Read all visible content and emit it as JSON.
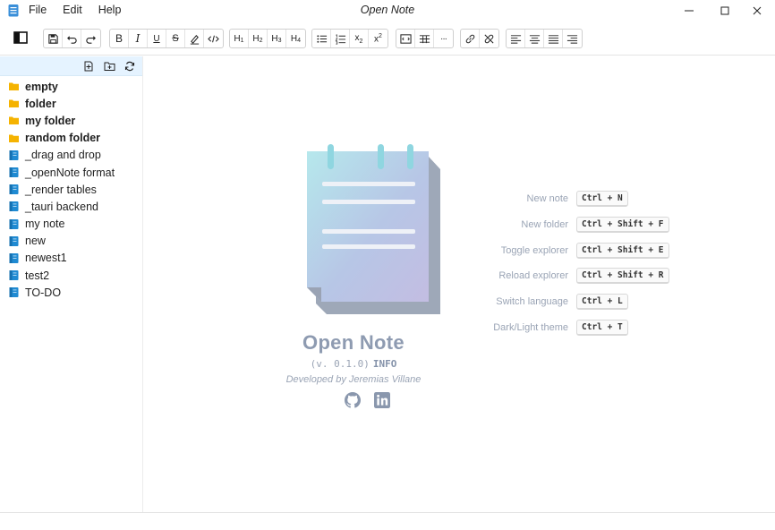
{
  "window": {
    "title": "Open Note",
    "menu": [
      "File",
      "Edit",
      "Help"
    ]
  },
  "toolbar": {
    "toggle_explorer_icon": "sidebar-toggle-icon",
    "groups": [
      [
        "save-icon",
        "undo-icon",
        "redo-icon"
      ],
      [
        "bold-icon",
        "italic-icon",
        "underline-icon",
        "strikethrough-icon",
        "highlight-icon",
        "code-icon"
      ],
      [
        "heading-1-icon",
        "heading-2-icon",
        "heading-3-icon",
        "heading-4-icon"
      ],
      [
        "bullet-list-icon",
        "numbered-list-icon",
        "subscript-icon",
        "superscript-icon"
      ],
      [
        "code-block-icon",
        "table-icon",
        "more-icon"
      ],
      [
        "link-icon",
        "unlink-icon"
      ],
      [
        "align-left-icon",
        "align-center-icon",
        "align-justify-icon",
        "align-right-icon"
      ]
    ],
    "labels": {
      "bold": "B",
      "italic": "I",
      "underline": "U",
      "strike": "S",
      "h1": "H",
      "h2": "H",
      "h3": "H",
      "h4": "H",
      "h1_n": "1",
      "h2_n": "2",
      "h3_n": "3",
      "h4_n": "4",
      "sub": "x",
      "sub_n": "2",
      "sup": "x",
      "sup_n": "2",
      "more": "···"
    }
  },
  "sidebar": {
    "header_icons": [
      "new-note-icon",
      "new-folder-icon",
      "reload-icon"
    ],
    "items": [
      {
        "label": "empty",
        "type": "folder"
      },
      {
        "label": "folder",
        "type": "folder"
      },
      {
        "label": "my folder",
        "type": "folder"
      },
      {
        "label": "random folder",
        "type": "folder"
      },
      {
        "label": "_drag and drop",
        "type": "note"
      },
      {
        "label": "_openNote format",
        "type": "note"
      },
      {
        "label": "_render tables",
        "type": "note"
      },
      {
        "label": "_tauri backend",
        "type": "note"
      },
      {
        "label": "my note",
        "type": "note"
      },
      {
        "label": "new",
        "type": "note"
      },
      {
        "label": "newest1",
        "type": "note"
      },
      {
        "label": "test2",
        "type": "note"
      },
      {
        "label": "TO-DO",
        "type": "note"
      }
    ]
  },
  "welcome": {
    "app_name": "Open Note",
    "version": "(v. 0.1.0)",
    "info": "INFO",
    "developer": "Developed by Jeremias Villane",
    "links": [
      "github-icon",
      "linkedin-icon"
    ]
  },
  "shortcuts": [
    {
      "label": "New note",
      "keys": "Ctrl + N"
    },
    {
      "label": "New folder",
      "keys": "Ctrl + Shift + F"
    },
    {
      "label": "Toggle explorer",
      "keys": "Ctrl + Shift + E"
    },
    {
      "label": "Reload explorer",
      "keys": "Ctrl + Shift + R"
    },
    {
      "label": "Switch language",
      "keys": "Ctrl + L"
    },
    {
      "label": "Dark/Light theme",
      "keys": "Ctrl + T"
    }
  ],
  "colors": {
    "folder": "#f5b301",
    "note": "#1f8ad2",
    "sidebar_header": "#e5f3ff",
    "muted_text": "#9aa4b5"
  }
}
